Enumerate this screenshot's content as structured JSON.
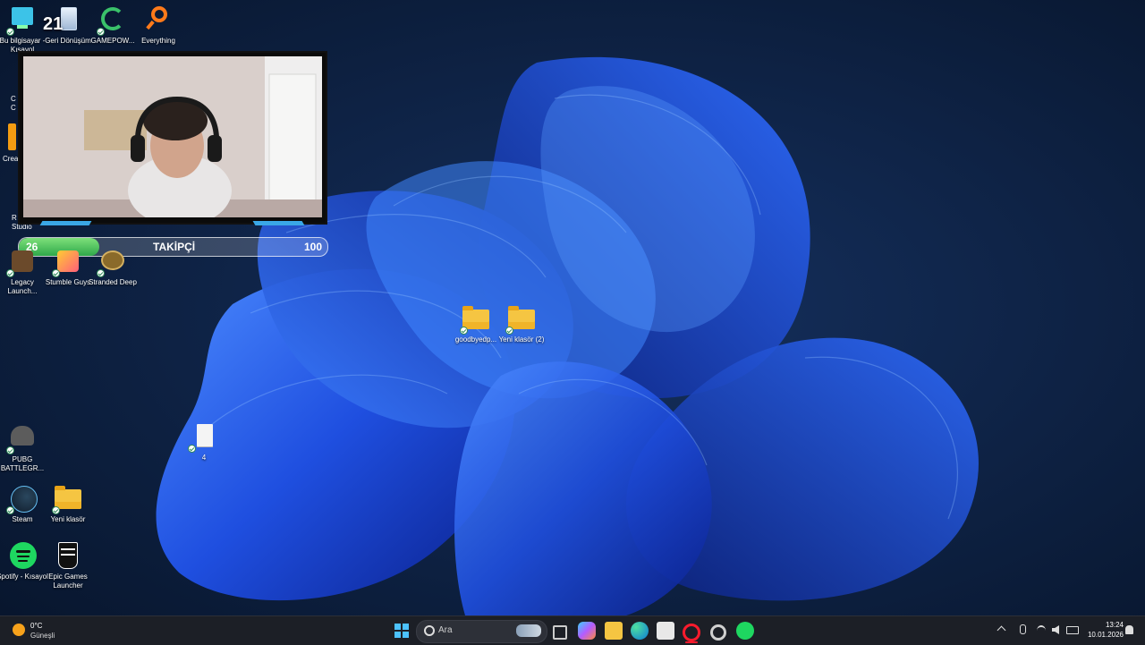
{
  "desktop": {
    "icons": [
      {
        "label": "Bu bilgisayar - Kısayol",
        "icon": "pc-icon"
      },
      {
        "label": "Geri Dönüşüm",
        "icon": "recycle-bin-icon"
      },
      {
        "label": "GAMEPOW...",
        "icon": "gamepower-icon"
      },
      {
        "label": "Everything",
        "icon": "magnifier-icon"
      },
      {
        "label": "Legacy Launch...",
        "icon": "legacy-launcher-icon"
      },
      {
        "label": "Stumble Guys",
        "icon": "stumble-guys-icon"
      },
      {
        "label": "Stranded Deep",
        "icon": "stranded-deep-icon"
      },
      {
        "label": "goodbyedp...",
        "icon": "folder-icon"
      },
      {
        "label": "Yeni klasör (2)",
        "icon": "folder-icon"
      },
      {
        "label": "4",
        "icon": "text-file-icon"
      },
      {
        "label": "PUBG BATTLEGR...",
        "icon": "pubg-icon"
      },
      {
        "label": "Steam",
        "icon": "steam-icon"
      },
      {
        "label": "Yeni klasör",
        "icon": "folder-icon"
      },
      {
        "label": "Spotify - Kısayol",
        "icon": "spotify-icon"
      },
      {
        "label": "Epic Games Launcher",
        "icon": "epic-games-icon"
      }
    ],
    "partial_labels": [
      "C",
      "C",
      "Crea",
      "R",
      "Studio"
    ],
    "overlay_number": "21"
  },
  "overlay": {
    "follower_label": "TAKİPÇİ",
    "current": "26",
    "goal": "100",
    "progress": 0.26
  },
  "taskbar": {
    "weather_temp": "0°C",
    "weather_desc": "Güneşli",
    "search_placeholder": "Ara",
    "time": "13:24",
    "date": "10.01.2026"
  }
}
